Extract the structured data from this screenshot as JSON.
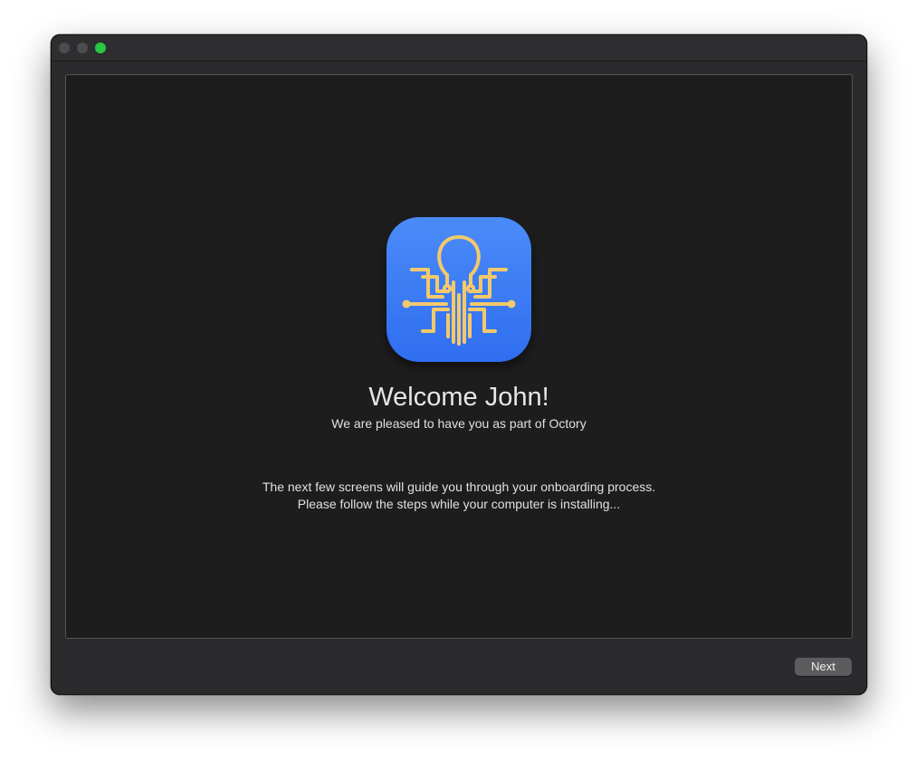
{
  "window": {
    "traffic_lights": [
      "close",
      "minimize",
      "zoom"
    ]
  },
  "app_icon": {
    "icon_name": "octory-octopus-icon",
    "colors": {
      "background_top": "#4b8bf8",
      "background_bottom": "#2f6ef0",
      "glyph": "#f3c96b"
    }
  },
  "welcome": {
    "title": "Welcome John!",
    "subtitle": "We are pleased to have you as part of Octory"
  },
  "guide": {
    "line1": "The next few screens will guide you through your onboarding process.",
    "line2": "Please follow the steps while your computer is installing..."
  },
  "footer": {
    "next_label": "Next"
  }
}
